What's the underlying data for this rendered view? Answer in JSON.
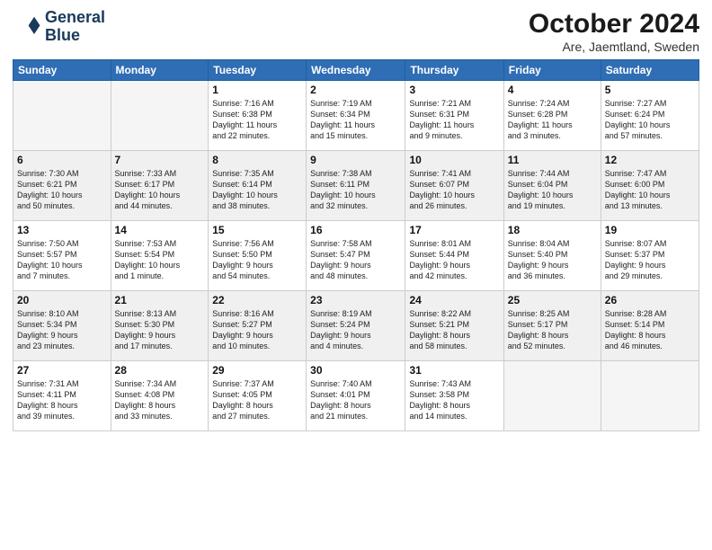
{
  "header": {
    "logo_line1": "General",
    "logo_line2": "Blue",
    "title": "October 2024",
    "subtitle": "Are, Jaemtland, Sweden"
  },
  "weekdays": [
    "Sunday",
    "Monday",
    "Tuesday",
    "Wednesday",
    "Thursday",
    "Friday",
    "Saturday"
  ],
  "weeks": [
    [
      {
        "day": "",
        "info": ""
      },
      {
        "day": "",
        "info": ""
      },
      {
        "day": "1",
        "info": "Sunrise: 7:16 AM\nSunset: 6:38 PM\nDaylight: 11 hours\nand 22 minutes."
      },
      {
        "day": "2",
        "info": "Sunrise: 7:19 AM\nSunset: 6:34 PM\nDaylight: 11 hours\nand 15 minutes."
      },
      {
        "day": "3",
        "info": "Sunrise: 7:21 AM\nSunset: 6:31 PM\nDaylight: 11 hours\nand 9 minutes."
      },
      {
        "day": "4",
        "info": "Sunrise: 7:24 AM\nSunset: 6:28 PM\nDaylight: 11 hours\nand 3 minutes."
      },
      {
        "day": "5",
        "info": "Sunrise: 7:27 AM\nSunset: 6:24 PM\nDaylight: 10 hours\nand 57 minutes."
      }
    ],
    [
      {
        "day": "6",
        "info": "Sunrise: 7:30 AM\nSunset: 6:21 PM\nDaylight: 10 hours\nand 50 minutes."
      },
      {
        "day": "7",
        "info": "Sunrise: 7:33 AM\nSunset: 6:17 PM\nDaylight: 10 hours\nand 44 minutes."
      },
      {
        "day": "8",
        "info": "Sunrise: 7:35 AM\nSunset: 6:14 PM\nDaylight: 10 hours\nand 38 minutes."
      },
      {
        "day": "9",
        "info": "Sunrise: 7:38 AM\nSunset: 6:11 PM\nDaylight: 10 hours\nand 32 minutes."
      },
      {
        "day": "10",
        "info": "Sunrise: 7:41 AM\nSunset: 6:07 PM\nDaylight: 10 hours\nand 26 minutes."
      },
      {
        "day": "11",
        "info": "Sunrise: 7:44 AM\nSunset: 6:04 PM\nDaylight: 10 hours\nand 19 minutes."
      },
      {
        "day": "12",
        "info": "Sunrise: 7:47 AM\nSunset: 6:00 PM\nDaylight: 10 hours\nand 13 minutes."
      }
    ],
    [
      {
        "day": "13",
        "info": "Sunrise: 7:50 AM\nSunset: 5:57 PM\nDaylight: 10 hours\nand 7 minutes."
      },
      {
        "day": "14",
        "info": "Sunrise: 7:53 AM\nSunset: 5:54 PM\nDaylight: 10 hours\nand 1 minute."
      },
      {
        "day": "15",
        "info": "Sunrise: 7:56 AM\nSunset: 5:50 PM\nDaylight: 9 hours\nand 54 minutes."
      },
      {
        "day": "16",
        "info": "Sunrise: 7:58 AM\nSunset: 5:47 PM\nDaylight: 9 hours\nand 48 minutes."
      },
      {
        "day": "17",
        "info": "Sunrise: 8:01 AM\nSunset: 5:44 PM\nDaylight: 9 hours\nand 42 minutes."
      },
      {
        "day": "18",
        "info": "Sunrise: 8:04 AM\nSunset: 5:40 PM\nDaylight: 9 hours\nand 36 minutes."
      },
      {
        "day": "19",
        "info": "Sunrise: 8:07 AM\nSunset: 5:37 PM\nDaylight: 9 hours\nand 29 minutes."
      }
    ],
    [
      {
        "day": "20",
        "info": "Sunrise: 8:10 AM\nSunset: 5:34 PM\nDaylight: 9 hours\nand 23 minutes."
      },
      {
        "day": "21",
        "info": "Sunrise: 8:13 AM\nSunset: 5:30 PM\nDaylight: 9 hours\nand 17 minutes."
      },
      {
        "day": "22",
        "info": "Sunrise: 8:16 AM\nSunset: 5:27 PM\nDaylight: 9 hours\nand 10 minutes."
      },
      {
        "day": "23",
        "info": "Sunrise: 8:19 AM\nSunset: 5:24 PM\nDaylight: 9 hours\nand 4 minutes."
      },
      {
        "day": "24",
        "info": "Sunrise: 8:22 AM\nSunset: 5:21 PM\nDaylight: 8 hours\nand 58 minutes."
      },
      {
        "day": "25",
        "info": "Sunrise: 8:25 AM\nSunset: 5:17 PM\nDaylight: 8 hours\nand 52 minutes."
      },
      {
        "day": "26",
        "info": "Sunrise: 8:28 AM\nSunset: 5:14 PM\nDaylight: 8 hours\nand 46 minutes."
      }
    ],
    [
      {
        "day": "27",
        "info": "Sunrise: 7:31 AM\nSunset: 4:11 PM\nDaylight: 8 hours\nand 39 minutes."
      },
      {
        "day": "28",
        "info": "Sunrise: 7:34 AM\nSunset: 4:08 PM\nDaylight: 8 hours\nand 33 minutes."
      },
      {
        "day": "29",
        "info": "Sunrise: 7:37 AM\nSunset: 4:05 PM\nDaylight: 8 hours\nand 27 minutes."
      },
      {
        "day": "30",
        "info": "Sunrise: 7:40 AM\nSunset: 4:01 PM\nDaylight: 8 hours\nand 21 minutes."
      },
      {
        "day": "31",
        "info": "Sunrise: 7:43 AM\nSunset: 3:58 PM\nDaylight: 8 hours\nand 14 minutes."
      },
      {
        "day": "",
        "info": ""
      },
      {
        "day": "",
        "info": ""
      }
    ]
  ]
}
